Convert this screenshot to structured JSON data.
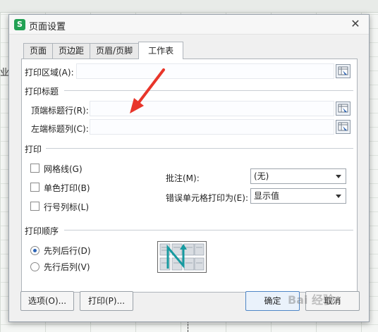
{
  "background": {
    "left_text": "业"
  },
  "dialog": {
    "app_icon": "S",
    "title": "页面设置",
    "close_glyph": "✕",
    "tabs": [
      {
        "label": "页面"
      },
      {
        "label": "页边距"
      },
      {
        "label": "页眉/页脚"
      },
      {
        "label": "工作表",
        "active": true
      }
    ],
    "print_area": {
      "label": "打印区域(A):",
      "value": ""
    },
    "print_titles": {
      "section": "打印标题",
      "top_rows": {
        "label": "顶端标题行(R):",
        "value": ""
      },
      "left_cols": {
        "label": "左端标题列(C):",
        "value": ""
      }
    },
    "print": {
      "section": "打印",
      "gridlines": {
        "label": "网格线(G)",
        "checked": false
      },
      "mono": {
        "label": "单色打印(B)",
        "checked": false
      },
      "headings": {
        "label": "行号列标(L)",
        "checked": false
      },
      "comments": {
        "label": "批注(M):",
        "value": "(无)"
      },
      "errors": {
        "label": "错误单元格打印为(E):",
        "value": "显示值"
      }
    },
    "order": {
      "section": "打印顺序",
      "down_then_over": {
        "label": "先列后行(D)",
        "selected": true
      },
      "over_then_down": {
        "label": "先行后列(V)",
        "selected": false
      }
    },
    "buttons": {
      "options": "选项(O)...",
      "print": "打印(P)...",
      "ok": "确定",
      "cancel": "取消"
    }
  },
  "annotation": {
    "arrow_color": "#e8352a"
  },
  "watermark": "Bai 经验",
  "colors": {
    "app_icon": "#22a154",
    "primary_border": "#4f86c6"
  }
}
